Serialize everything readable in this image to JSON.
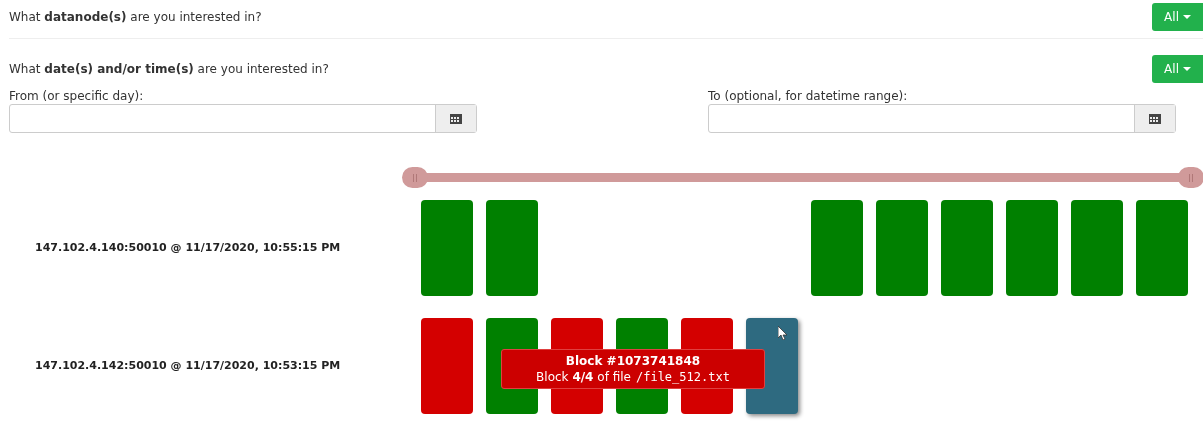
{
  "datanode_question": {
    "text": "What **datanode(s)** are you interested in?",
    "button": "All"
  },
  "date_question": {
    "text": "What **date(s) and/or time(s)** are you interested in?",
    "button": "All"
  },
  "from_field": {
    "label": "From (or specific day):"
  },
  "to_field": {
    "label": "To (optional, for datetime range):"
  },
  "range_slider": {
    "handles": [
      {
        "level": 0
      },
      {
        "level": 1
      }
    ]
  },
  "rows": [
    {
      "label": "147.102.4.140:50010 @ 11/17/2020, 10:55:15 PM",
      "blocks": [
        {
          "kind": "block",
          "color": "#008000",
          "selected": false
        },
        {
          "kind": "block",
          "color": "#008000",
          "selected": false
        },
        {
          "kind": "gap"
        },
        {
          "kind": "gap"
        },
        {
          "kind": "gap"
        },
        {
          "kind": "gap"
        },
        {
          "kind": "block",
          "color": "#008000",
          "selected": false
        },
        {
          "kind": "block",
          "color": "#008000",
          "selected": false
        },
        {
          "kind": "block",
          "color": "#008000",
          "selected": false
        },
        {
          "kind": "block",
          "color": "#008000",
          "selected": false
        },
        {
          "kind": "block",
          "color": "#008000",
          "selected": false
        },
        {
          "kind": "block",
          "color": "#008000",
          "selected": false
        }
      ]
    },
    {
      "label": "147.102.4.142:50010 @ 11/17/2020, 10:53:15 PM",
      "blocks": [
        {
          "kind": "block",
          "color": "#d40000",
          "selected": false
        },
        {
          "kind": "block",
          "color": "#008000",
          "selected": false
        },
        {
          "kind": "block",
          "color": "#d40000",
          "selected": false
        },
        {
          "kind": "block",
          "color": "#008000",
          "selected": false
        },
        {
          "kind": "block",
          "color": "#d40000",
          "selected": false
        },
        {
          "kind": "block",
          "color": "#2e6a80",
          "selected": true
        }
      ],
      "tooltip": {
        "title": "Block #1073741848",
        "text": "Block **4/4** of file",
        "file": "/file_512.txt"
      }
    }
  ]
}
